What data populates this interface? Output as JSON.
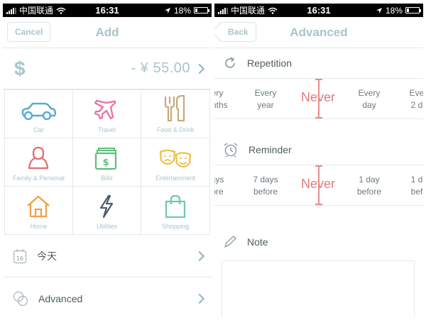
{
  "status": {
    "carrier": "中国联通",
    "time": "16:31",
    "battery": "18%"
  },
  "add": {
    "title": "Add",
    "cancel": "Cancel",
    "currency_symbol": "$",
    "amount": "- ¥ 55.00",
    "categories": [
      {
        "label": "Car",
        "icon": "car-icon",
        "color": "#5aa9d6"
      },
      {
        "label": "Travel",
        "icon": "plane-icon",
        "color": "#e86fa2"
      },
      {
        "label": "Food & Drink",
        "icon": "fork-knife-icon",
        "color": "#c8a97a"
      },
      {
        "label": "Family & Personal",
        "icon": "person-icon",
        "color": "#e66d6d"
      },
      {
        "label": "Bills",
        "icon": "bills-icon",
        "color": "#5cc07a"
      },
      {
        "label": "Entertainment",
        "icon": "masks-icon",
        "color": "#f0c04a"
      },
      {
        "label": "Home",
        "icon": "house-icon",
        "color": "#f0a04a"
      },
      {
        "label": "Utilities",
        "icon": "bolt-icon",
        "color": "#4f5b6e"
      },
      {
        "label": "Shopping",
        "icon": "bag-icon",
        "color": "#6fcab0"
      }
    ],
    "date_icon_text": "16",
    "date_label": "今天",
    "advanced_label": "Advanced"
  },
  "advanced": {
    "title": "Advanced",
    "back": "Back",
    "repetition": {
      "label": "Repetition",
      "options": [
        "ery\nonths",
        "Every\nyear",
        "Never",
        "Every\nday",
        "Eve\n2 d"
      ]
    },
    "reminder": {
      "label": "Reminder",
      "options": [
        "ays\nore",
        "7 days\nbefore",
        "Never",
        "1 day\nbefore",
        "1 d\nbef"
      ]
    },
    "note_label": "Note"
  }
}
